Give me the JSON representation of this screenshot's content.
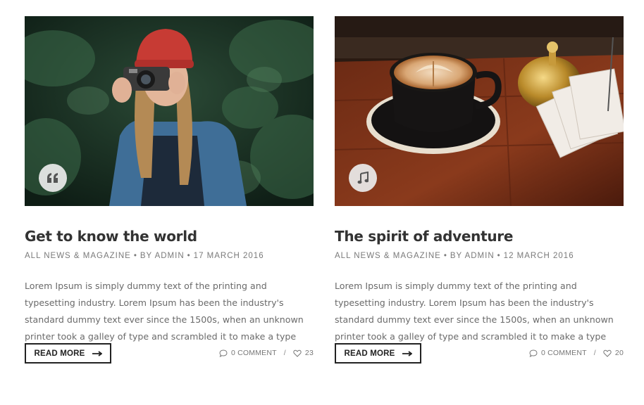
{
  "posts": [
    {
      "title": "Get to know the world",
      "category": "ALL NEWS & MAGAZINE",
      "author": "BY ADMIN",
      "date": "17 MARCH 2016",
      "excerpt": "Lorem Ipsum is simply dummy text of the printing and typesetting industry. Lorem Ipsum has been the industry's standard dummy text ever since the 1500s, when an unknown printer took a galley of type and scrambled it to make a type specimen...",
      "read_more": "READ MORE",
      "comments": "0 COMMENT",
      "likes": "23",
      "format_icon": "quote-icon",
      "image": "woman-with-camera-photo"
    },
    {
      "title": "The spirit of adventure",
      "category": "ALL NEWS & MAGAZINE",
      "author": "BY ADMIN",
      "date": "12 MARCH 2016",
      "excerpt": "Lorem Ipsum is simply dummy text of the printing and typesetting industry. Lorem Ipsum has been the industry's standard dummy text ever since the 1500s, when an unknown printer took a galley of type and scrambled it to make a type specimen...",
      "read_more": "READ MORE",
      "comments": "0 COMMENT",
      "likes": "20",
      "format_icon": "music-note-icon",
      "image": "coffee-cup-photo"
    }
  ],
  "separators": {
    "dot": "•",
    "slash": "/"
  },
  "colors": {
    "text_dark": "#333333",
    "meta_gray": "#7a7a7a",
    "border": "#222222"
  }
}
